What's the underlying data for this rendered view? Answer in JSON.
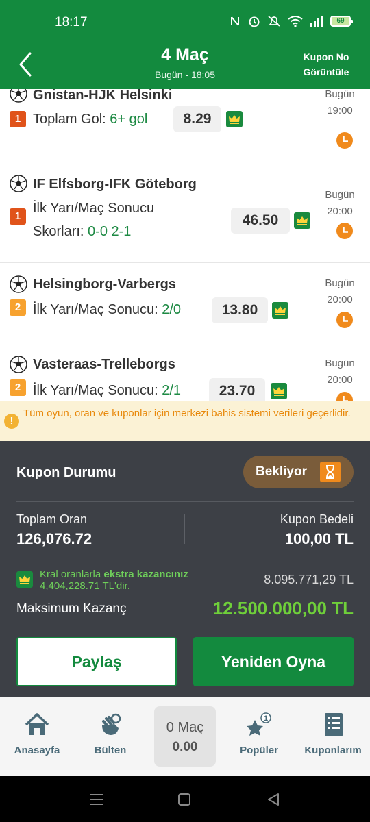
{
  "status_bar": {
    "time": "18:17",
    "battery": "69"
  },
  "header": {
    "title": "4 Maç",
    "subtitle": "Bugün - 18:05",
    "coupon_no_line1": "Kupon No",
    "coupon_no_line2": "Görüntüle"
  },
  "matches": [
    {
      "teams": "Gnistan-HJK Helsinki",
      "mbs": "1",
      "bet_label": "Toplam Gol:",
      "selection": "6+ gol",
      "odd": "8.29",
      "day": "Bugün",
      "time": "19:00"
    },
    {
      "teams": "IF Elfsborg-IFK Göteborg",
      "mbs": "1",
      "bet_label_line1": "İlk Yarı/Maç Sonucu",
      "bet_label_line2": "Skorları:",
      "selection": "0-0 2-1",
      "odd": "46.50",
      "day": "Bugün",
      "time": "20:00"
    },
    {
      "teams": "Helsingborg-Varbergs",
      "mbs": "2",
      "bet_label": "İlk Yarı/Maç Sonucu:",
      "selection": "2/0",
      "odd": "13.80",
      "day": "Bugün",
      "time": "20:00"
    },
    {
      "teams": "Vasteraas-Trelleborgs",
      "mbs": "2",
      "bet_label": "İlk Yarı/Maç Sonucu:",
      "selection": "2/1",
      "odd": "23.70",
      "day": "Bugün",
      "time": "20:00"
    }
  ],
  "info": {
    "text": "Tüm oyun, oran ve kuponlar için merkezi bahis sistemi verileri geçerlidir."
  },
  "coupon": {
    "status_title": "Kupon Durumu",
    "status_value": "Bekliyor",
    "total_odds_label": "Toplam Oran",
    "total_odds_value": "126,076.72",
    "stake_label": "Kupon Bedeli",
    "stake_value": "100,00 TL",
    "king_text_prefix": "Kral oranlarla ",
    "king_text_bold": "ekstra kazancınız",
    "king_text_suffix": "4,404,228.71 TL'dir.",
    "old_win": "8.095.771,29 TL",
    "max_win_label": "Maksimum Kazanç",
    "max_win_value": "12.500.000,00 TL",
    "share_label": "Paylaş",
    "replay_label": "Yeniden Oyna"
  },
  "bottom_nav": {
    "home": "Anasayfa",
    "bulletin": "Bülten",
    "center_count": "0 Maç",
    "center_odds": "0.00",
    "popular": "Popüler",
    "popular_badge": "1",
    "coupons": "Kuponlarım"
  },
  "colors": {
    "primary_green": "#138a3e",
    "panel_dark": "#3d4046",
    "orange": "#f08a1c",
    "light_green": "#6fcf3a"
  }
}
